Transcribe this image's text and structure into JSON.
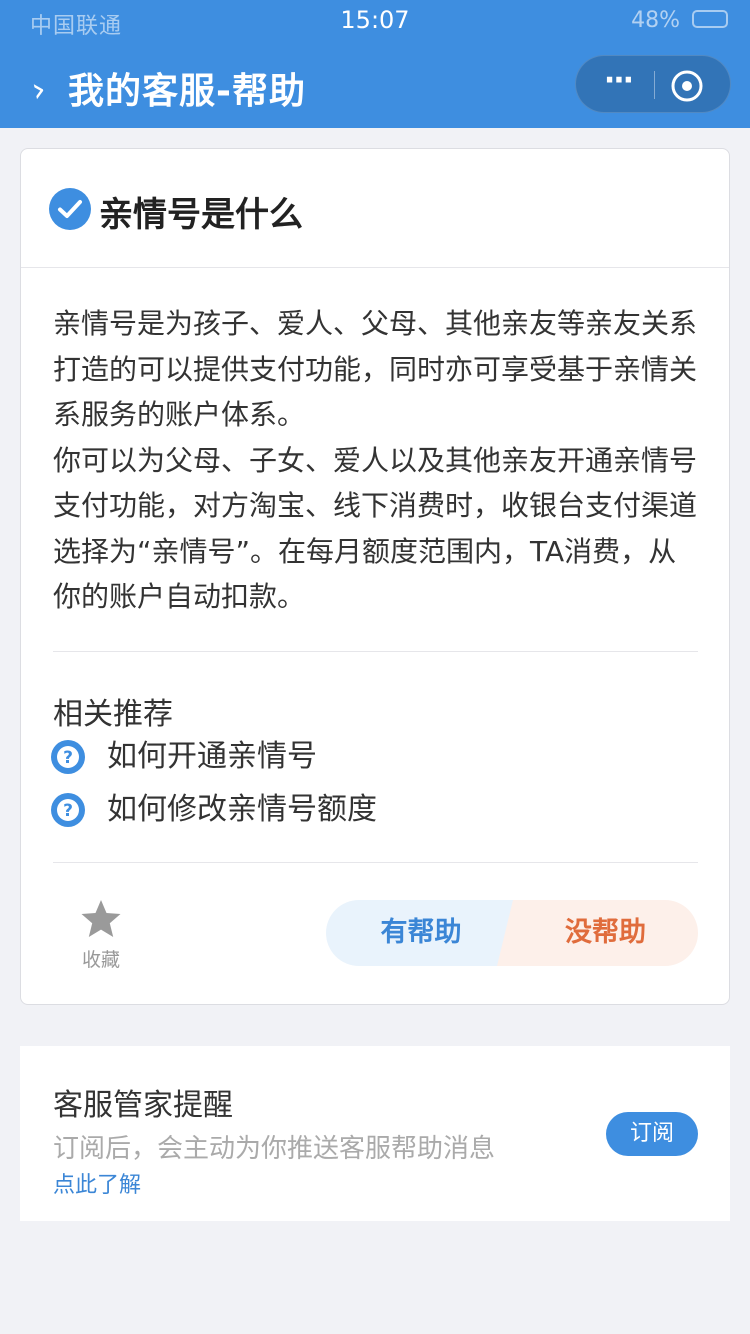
{
  "status_bar": {
    "carrier": "中国联通",
    "time": "15:07",
    "battery": "48%"
  },
  "nav": {
    "title": "我的客服-帮助",
    "more_icon": "ellipsis-icon",
    "close_icon": "close-circle-icon"
  },
  "article": {
    "title": "亲情号是什么",
    "paragraphs": [
      "亲情号是为孩子、爱人、父母、其他亲友等亲友关系打造的可以提供支付功能，同时亦可享受基于亲情关系服务的账户体系。",
      "你可以为父母、子女、爱人以及其他亲友开通亲情号支付功能，对方淘宝、线下消费时，收银台支付渠道选择为“亲情号”。在每月额度范围内，TA消费，从你的账户自动扣款。"
    ],
    "related_title": "相关推荐",
    "related": [
      {
        "label": "如何开通亲情号"
      },
      {
        "label": "如何修改亲情号额度"
      }
    ],
    "favorite_label": "收藏",
    "helpful_label": "有帮助",
    "not_helpful_label": "没帮助"
  },
  "subscribe": {
    "title": "客服管家提醒",
    "description": "订阅后，会主动为你推送客服帮助消息",
    "link": "点此了解",
    "button": "订阅"
  },
  "colors": {
    "brand": "#3e8ee0",
    "helpful_text": "#3b86d6",
    "not_helpful_text": "#e06c3c"
  }
}
